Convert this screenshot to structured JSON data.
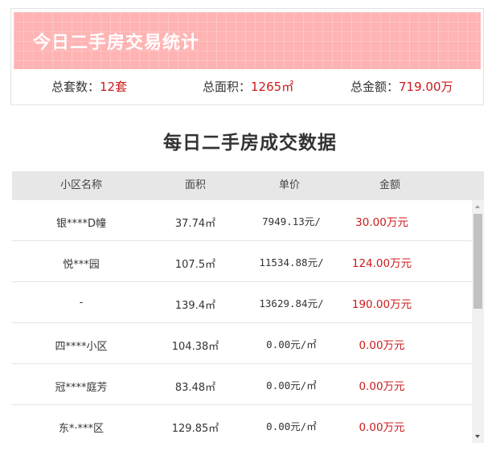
{
  "summary": {
    "title": "今日二手房交易统计",
    "total_count_label": "总套数：",
    "total_count_value": "12套",
    "total_area_label": "总面积：",
    "total_area_value": "1265㎡",
    "total_amount_label": "总金额：",
    "total_amount_value": "719.00万"
  },
  "section_title": "每日二手房成交数据",
  "table": {
    "headers": [
      "小区名称",
      "面积",
      "单价",
      "金额"
    ],
    "rows": [
      {
        "name": "银****D幢",
        "area": "37.74㎡",
        "price": "7949.13元/",
        "amount": "30.00万元"
      },
      {
        "name": "悦***园",
        "area": "107.5㎡",
        "price": "11534.88元/",
        "amount": "124.00万元"
      },
      {
        "name": "-",
        "area": "139.4㎡",
        "price": "13629.84元/",
        "amount": "190.00万元"
      },
      {
        "name": "四****小区",
        "area": "104.38㎡",
        "price": "0.00元/㎡",
        "amount": "0.00万元"
      },
      {
        "name": "冠****庭芳",
        "area": "83.48㎡",
        "price": "0.00元/㎡",
        "amount": "0.00万元"
      },
      {
        "name": "东*·***区",
        "area": "129.85㎡",
        "price": "0.00元/㎡",
        "amount": "0.00万元"
      }
    ]
  },
  "colors": {
    "banner": "#ffb3b3",
    "accent_red": "#cc1b1b",
    "header_bg": "#e7e7e7"
  }
}
